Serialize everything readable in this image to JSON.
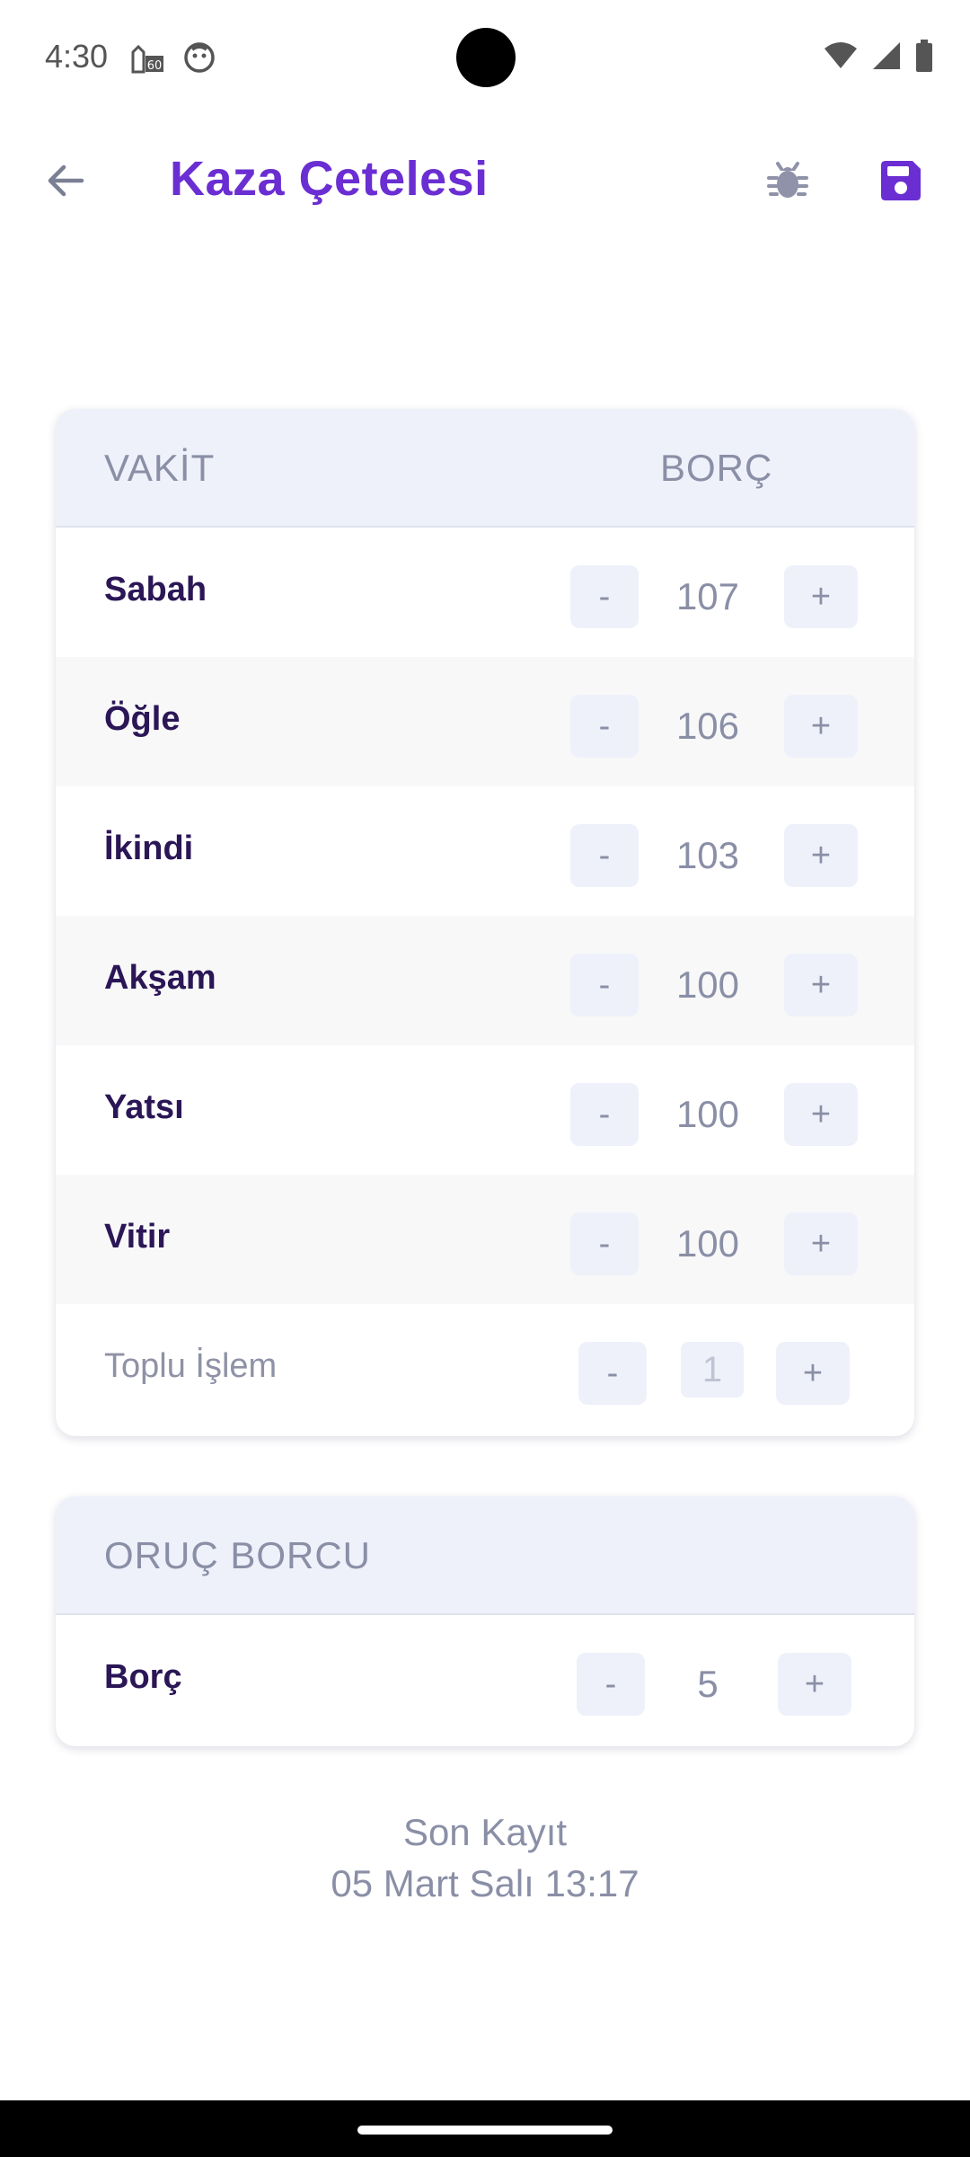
{
  "status_bar": {
    "time": "4:30",
    "icon_left_1": "mosque-60-icon",
    "icon_left_2": "face-icon",
    "icon_right": [
      "wifi-icon",
      "signal-icon",
      "battery-icon"
    ]
  },
  "app_bar": {
    "title": "Kaza Çetelesi",
    "back_icon": "arrow-left-icon",
    "bug_icon": "bug-icon",
    "save_icon": "save-icon"
  },
  "prayer_table": {
    "header_left": "VAKİT",
    "header_right": "BORÇ",
    "rows": [
      {
        "name": "Sabah",
        "value": "107"
      },
      {
        "name": "Öğle",
        "value": "106"
      },
      {
        "name": "İkindi",
        "value": "103"
      },
      {
        "name": "Akşam",
        "value": "100"
      },
      {
        "name": "Yatsı",
        "value": "100"
      },
      {
        "name": "Vitir",
        "value": "100"
      }
    ],
    "bulk": {
      "name": "Toplu İşlem",
      "value": "1"
    },
    "minus_label": "-",
    "plus_label": "+"
  },
  "fast_table": {
    "header": "ORUÇ BORCU",
    "row": {
      "name": "Borç",
      "value": "5"
    }
  },
  "footer": {
    "title": "Son Kayıt",
    "date": "05 Mart Salı 13:17"
  },
  "colors": {
    "accent": "#6a2ed2",
    "header_bg": "#eef1fa",
    "text_dark": "#2b1656",
    "text_muted": "#8a8fa6"
  }
}
